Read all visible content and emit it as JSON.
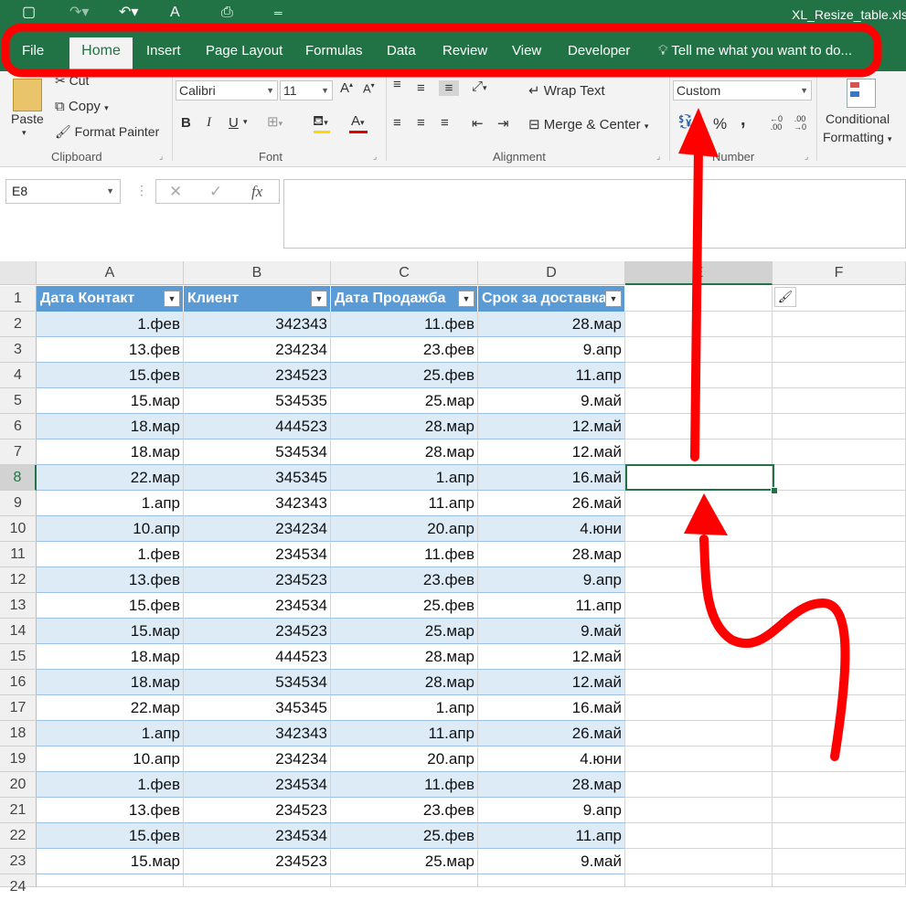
{
  "window": {
    "title": "XL_Resize_table.xlsx"
  },
  "quick_access": {
    "save_icon": "save-icon",
    "undo_icon": "undo-icon",
    "redo_icon": "redo-icon",
    "font_icon": "A",
    "preview_icon": "print-preview-icon"
  },
  "tabs": [
    "File",
    "Home",
    "Insert",
    "Page Layout",
    "Formulas",
    "Data",
    "Review",
    "View",
    "Developer"
  ],
  "tell_me": "Tell me what you want to do...",
  "ribbon": {
    "clipboard": {
      "paste": "Paste",
      "cut": "Cut",
      "copy": "Copy",
      "format_painter": "Format Painter",
      "group": "Clipboard"
    },
    "font": {
      "name": "Calibri",
      "size": "11",
      "bold": "B",
      "italic": "I",
      "underline": "U",
      "group": "Font"
    },
    "alignment": {
      "wrap_text": "Wrap Text",
      "merge_center": "Merge & Center",
      "group": "Alignment"
    },
    "number": {
      "format": "Custom",
      "percent": "%",
      "comma": ",",
      "group": "Number"
    },
    "styles": {
      "conditional": "Conditional",
      "formatting": "Formatting"
    }
  },
  "formula_bar": {
    "name_box": "E8",
    "cancel": "✕",
    "enter": "✓",
    "fx": "fx",
    "formula": ""
  },
  "columns": [
    "A",
    "B",
    "C",
    "D",
    "E",
    "F"
  ],
  "selected_column": "E",
  "selected_row": "8",
  "table": {
    "headers": [
      "Дата Контакт",
      "Клиент",
      "Дата Продажба",
      "Срок за доставка"
    ],
    "rows": [
      [
        "1.фев",
        "342343",
        "11.фев",
        "28.мар"
      ],
      [
        "13.фев",
        "234234",
        "23.фев",
        "9.апр"
      ],
      [
        "15.фев",
        "234523",
        "25.фев",
        "11.апр"
      ],
      [
        "15.мар",
        "534535",
        "25.мар",
        "9.май"
      ],
      [
        "18.мар",
        "444523",
        "28.мар",
        "12.май"
      ],
      [
        "18.мар",
        "534534",
        "28.мар",
        "12.май"
      ],
      [
        "22.мар",
        "345345",
        "1.апр",
        "16.май"
      ],
      [
        "1.апр",
        "342343",
        "11.апр",
        "26.май"
      ],
      [
        "10.апр",
        "234234",
        "20.апр",
        "4.юни"
      ],
      [
        "1.фев",
        "234534",
        "11.фев",
        "28.мар"
      ],
      [
        "13.фев",
        "234523",
        "23.фев",
        "9.апр"
      ],
      [
        "15.фев",
        "234534",
        "25.фев",
        "11.апр"
      ],
      [
        "15.мар",
        "234523",
        "25.мар",
        "9.май"
      ],
      [
        "18.мар",
        "444523",
        "28.мар",
        "12.май"
      ],
      [
        "18.мар",
        "534534",
        "28.мар",
        "12.май"
      ],
      [
        "22.мар",
        "345345",
        "1.апр",
        "16.май"
      ],
      [
        "1.апр",
        "342343",
        "11.апр",
        "26.май"
      ],
      [
        "10.апр",
        "234234",
        "20.апр",
        "4.юни"
      ],
      [
        "1.фев",
        "234534",
        "11.фев",
        "28.мар"
      ],
      [
        "13.фев",
        "234523",
        "23.фев",
        "9.апр"
      ],
      [
        "15.фев",
        "234534",
        "25.фев",
        "11.апр"
      ],
      [
        "15.мар",
        "234523",
        "25.мар",
        "9.май"
      ]
    ]
  },
  "row_numbers": [
    "1",
    "2",
    "3",
    "4",
    "5",
    "6",
    "7",
    "8",
    "9",
    "10",
    "11",
    "12",
    "13",
    "14",
    "15",
    "16",
    "17",
    "18",
    "19",
    "20",
    "21",
    "22",
    "23",
    "24"
  ],
  "colors": {
    "excel_green": "#217346",
    "table_header": "#5b9bd5",
    "table_band": "#ddebf7",
    "annotation_red": "#ff0000"
  }
}
